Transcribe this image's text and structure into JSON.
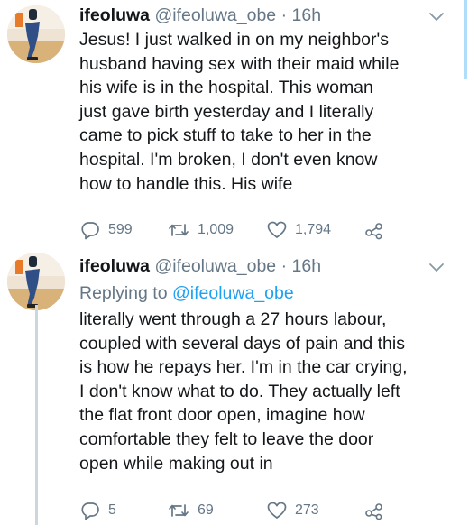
{
  "tweets": [
    {
      "name": "ifeoluwa",
      "handle": "@ifeoluwa_obe",
      "separator": "·",
      "time": "16h",
      "lines": [
        "Jesus! I just walked in on my neighbor's",
        "husband having sex with their maid while",
        "his wife is in the hospital. This woman",
        "just gave birth yesterday and I literally",
        "came to pick stuff to take to her in the",
        "hospital. I'm broken, I don't even know",
        "how to handle this. His wife"
      ],
      "actions": {
        "reply_count": "599",
        "retweet_count": "1,009",
        "like_count": "1,794"
      }
    },
    {
      "name": "ifeoluwa",
      "handle": "@ifeoluwa_obe",
      "separator": "·",
      "time": "16h",
      "replying_prefix": "Replying to",
      "replying_handle": "@ifeoluwa_obe",
      "lines": [
        "literally went through a 27 hours  labour,",
        "coupled with several days of pain and this",
        "is how he repays her. I'm in the car crying,",
        "I don't know what to do. They actually left",
        "the flat front door open, imagine how",
        "comfortable they felt to leave the door",
        "open while making out in"
      ],
      "actions": {
        "reply_count": "5",
        "retweet_count": "69",
        "like_count": "273"
      }
    }
  ],
  "colors": {
    "link": "#1da1f2",
    "secondary": "#657786",
    "text": "#14171a",
    "thread_line": "#ccd6dd"
  },
  "icons": [
    "reply-icon",
    "retweet-icon",
    "like-icon",
    "share-icon",
    "chevron-down-icon"
  ]
}
